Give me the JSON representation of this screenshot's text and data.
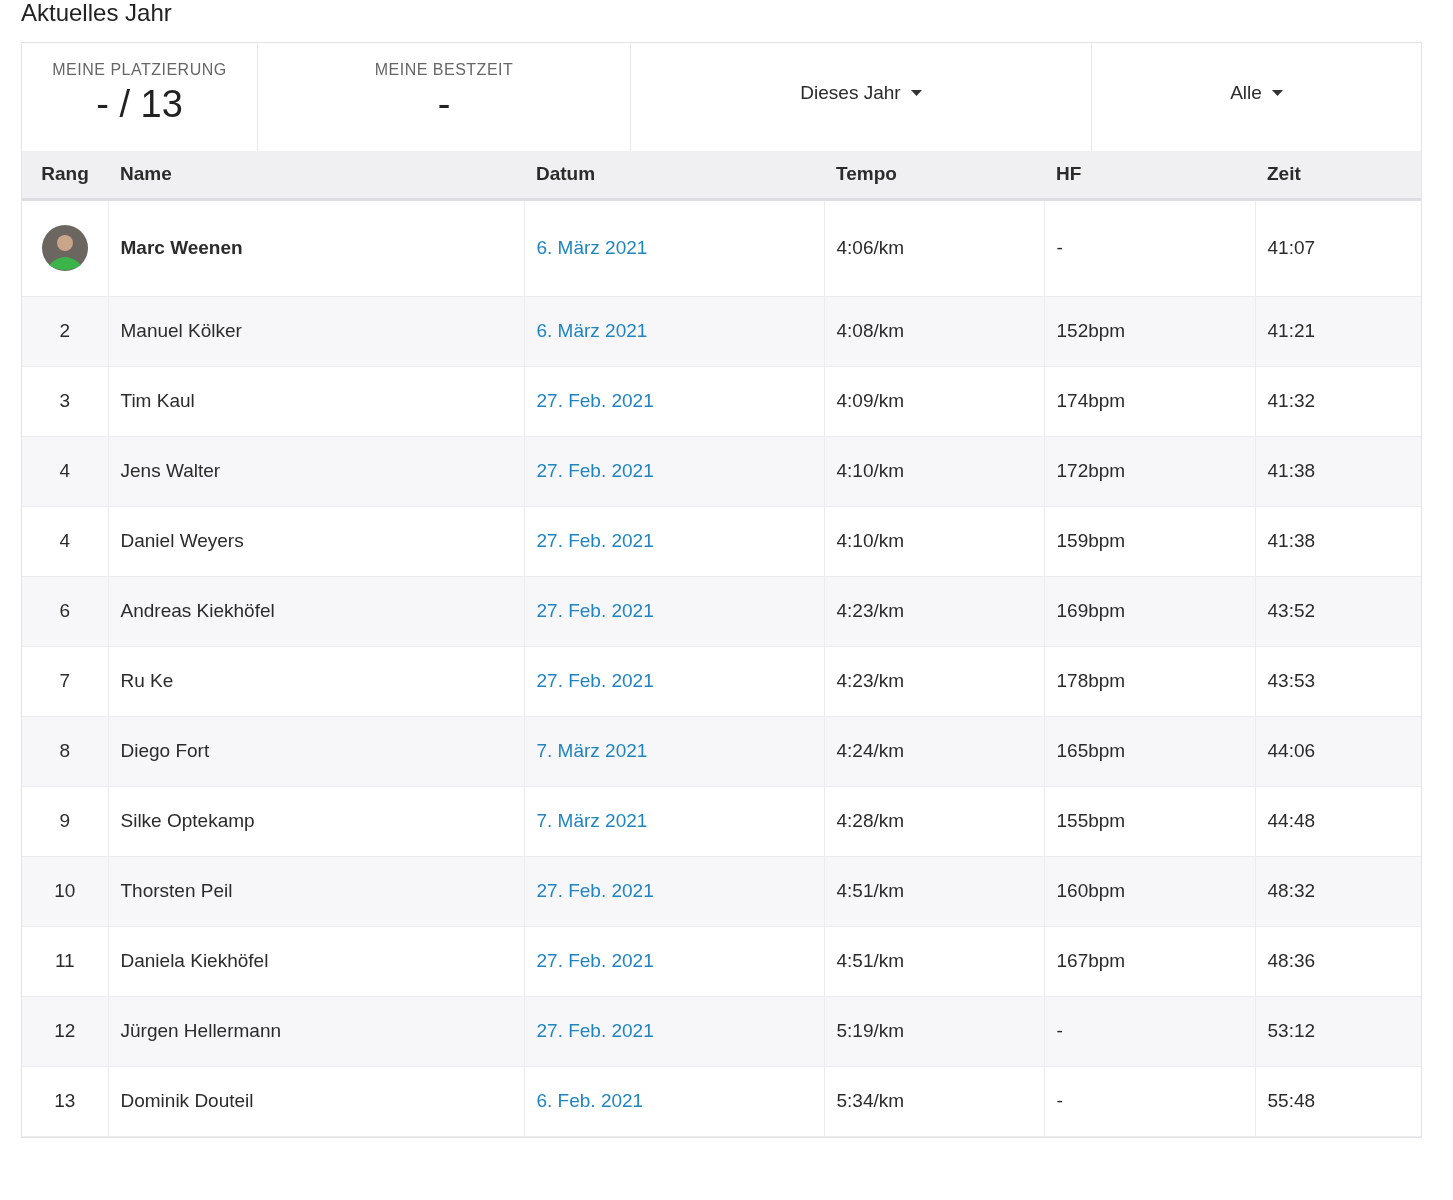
{
  "title": "Aktuelles Jahr",
  "stats": [
    {
      "label": "MEINE PLATZIERUNG",
      "value": "- / 13"
    },
    {
      "label": "MEINE BESTZEIT",
      "value": "-"
    }
  ],
  "filters": [
    {
      "label": "Dieses Jahr"
    },
    {
      "label": "Alle"
    }
  ],
  "table": {
    "columns": [
      "Rang",
      "Name",
      "Datum",
      "Tempo",
      "HF",
      "Zeit"
    ],
    "rows": [
      {
        "kind": "avatar",
        "highlighted": true,
        "name": "Marc Weenen",
        "date": "6. März 2021",
        "pace": "4:06/km",
        "hr": "-",
        "time": "41:07"
      },
      {
        "kind": "rank",
        "highlighted": false,
        "rank": "2",
        "name": "Manuel Kölker",
        "date": "6. März 2021",
        "pace": "4:08/km",
        "hr": "152bpm",
        "time": "41:21"
      },
      {
        "kind": "rank",
        "highlighted": false,
        "rank": "3",
        "name": "Tim Kaul",
        "date": "27. Feb. 2021",
        "pace": "4:09/km",
        "hr": "174bpm",
        "time": "41:32"
      },
      {
        "kind": "rank",
        "highlighted": false,
        "rank": "4",
        "name": "Jens Walter",
        "date": "27. Feb. 2021",
        "pace": "4:10/km",
        "hr": "172bpm",
        "time": "41:38"
      },
      {
        "kind": "rank",
        "highlighted": false,
        "rank": "4",
        "name": "Daniel Weyers",
        "date": "27. Feb. 2021",
        "pace": "4:10/km",
        "hr": "159bpm",
        "time": "41:38"
      },
      {
        "kind": "rank",
        "highlighted": false,
        "rank": "6",
        "name": "Andreas Kiekhöfel",
        "date": "27. Feb. 2021",
        "pace": "4:23/km",
        "hr": "169bpm",
        "time": "43:52"
      },
      {
        "kind": "rank",
        "highlighted": false,
        "rank": "7",
        "name": "Ru Ke",
        "date": "27. Feb. 2021",
        "pace": "4:23/km",
        "hr": "178bpm",
        "time": "43:53"
      },
      {
        "kind": "rank",
        "highlighted": false,
        "rank": "8",
        "name": "Diego Fort",
        "date": "7. März 2021",
        "pace": "4:24/km",
        "hr": "165bpm",
        "time": "44:06"
      },
      {
        "kind": "rank",
        "highlighted": false,
        "rank": "9",
        "name": "Silke Optekamp",
        "date": "7. März 2021",
        "pace": "4:28/km",
        "hr": "155bpm",
        "time": "44:48"
      },
      {
        "kind": "rank",
        "highlighted": false,
        "rank": "10",
        "name": "Thorsten Peil",
        "date": "27. Feb. 2021",
        "pace": "4:51/km",
        "hr": "160bpm",
        "time": "48:32"
      },
      {
        "kind": "rank",
        "highlighted": false,
        "rank": "11",
        "name": "Daniela Kiekhöfel",
        "date": "27. Feb. 2021",
        "pace": "4:51/km",
        "hr": "167bpm",
        "time": "48:36"
      },
      {
        "kind": "rank",
        "highlighted": false,
        "rank": "12",
        "name": "Jürgen Hellermann",
        "date": "27. Feb. 2021",
        "pace": "5:19/km",
        "hr": "-",
        "time": "53:12"
      },
      {
        "kind": "rank",
        "highlighted": false,
        "rank": "13",
        "name": "Dominik Douteil",
        "date": "6. Feb. 2021",
        "pace": "5:34/km",
        "hr": "-",
        "time": "55:48"
      }
    ]
  }
}
